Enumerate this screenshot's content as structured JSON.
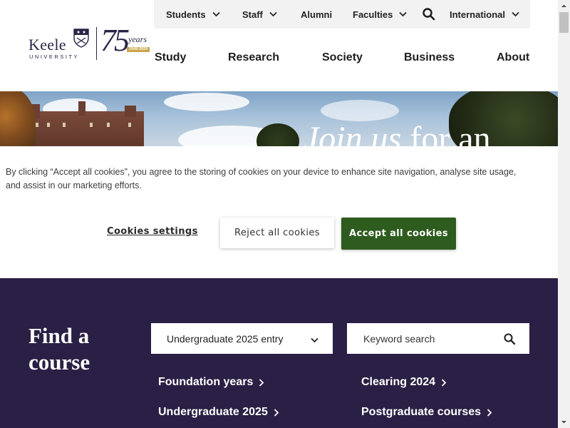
{
  "utility_nav": {
    "items": [
      {
        "label": "Students",
        "has_dropdown": true
      },
      {
        "label": "Staff",
        "has_dropdown": true
      },
      {
        "label": "Alumni",
        "has_dropdown": false
      },
      {
        "label": "Faculties",
        "has_dropdown": true
      },
      {
        "label": "International",
        "has_dropdown": true
      }
    ],
    "search_icon": "search-icon"
  },
  "logo": {
    "brand_word": "Keele",
    "brand_sub": "UNIVERSITY",
    "anniversary_number": "75",
    "anniversary_word": "years",
    "anniversary_dates": "1949-2024"
  },
  "main_nav": {
    "items": [
      "Study",
      "Research",
      "Society",
      "Business",
      "About"
    ]
  },
  "hero": {
    "headline_part1": "Join us",
    "headline_part2": " for an"
  },
  "cookie_banner": {
    "message": "By clicking “Accept all cookies”, you agree to the storing of cookies on your device to enhance site navigation, analyse site usage, and assist in our marketing efforts.",
    "settings_label": "Cookies settings",
    "reject_label": "Reject all cookies",
    "accept_label": "Accept all cookies"
  },
  "find_course": {
    "title": "Find a course",
    "entry_select_value": "Undergraduate 2025 entry",
    "keyword_placeholder": "Keyword search",
    "links": [
      {
        "label": "Foundation years"
      },
      {
        "label": "Clearing 2024"
      },
      {
        "label": "Undergraduate 2025"
      },
      {
        "label": "Postgraduate courses"
      }
    ]
  },
  "colors": {
    "accent_green": "#2e5b1e",
    "course_bg": "#2a1f44",
    "utility_bg": "#f2f2f2",
    "brand_navy": "#2a2547",
    "brand_gold": "#c9a54b"
  }
}
